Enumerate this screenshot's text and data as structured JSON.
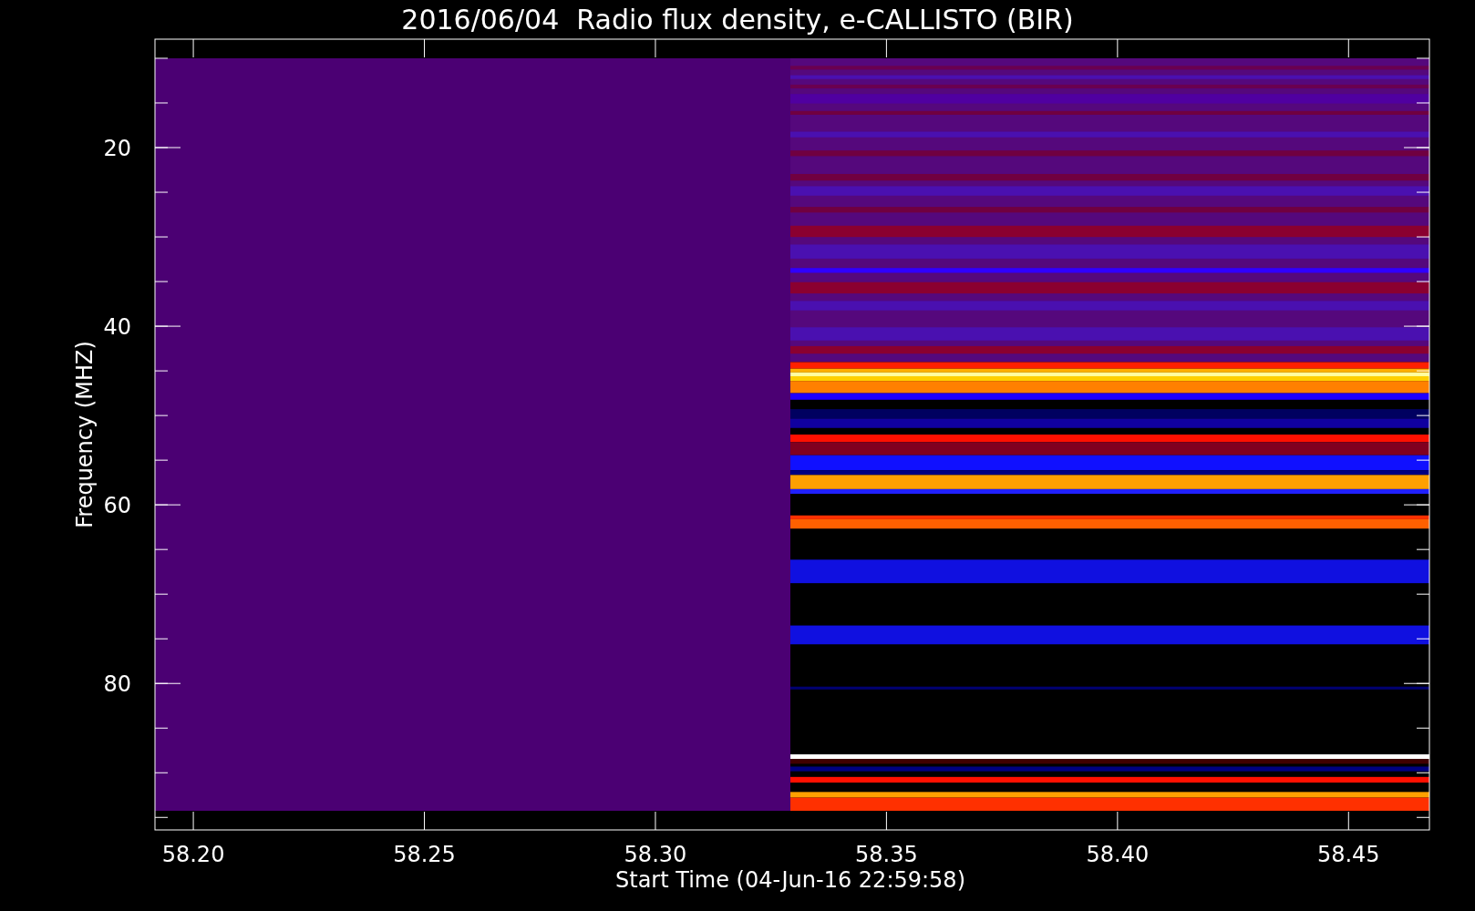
{
  "title": "2016/06/04  Radio flux density, e-CALLISTO (BIR)",
  "axes": {
    "xlabel": "Start Time (04-Jun-16 22:59:58)",
    "ylabel": "Frequency (MHZ)",
    "xticks": [
      "58.20",
      "58.25",
      "58.30",
      "58.35",
      "58.40",
      "58.45"
    ],
    "yticks": [
      "20",
      "40",
      "60",
      "80"
    ]
  }
}
